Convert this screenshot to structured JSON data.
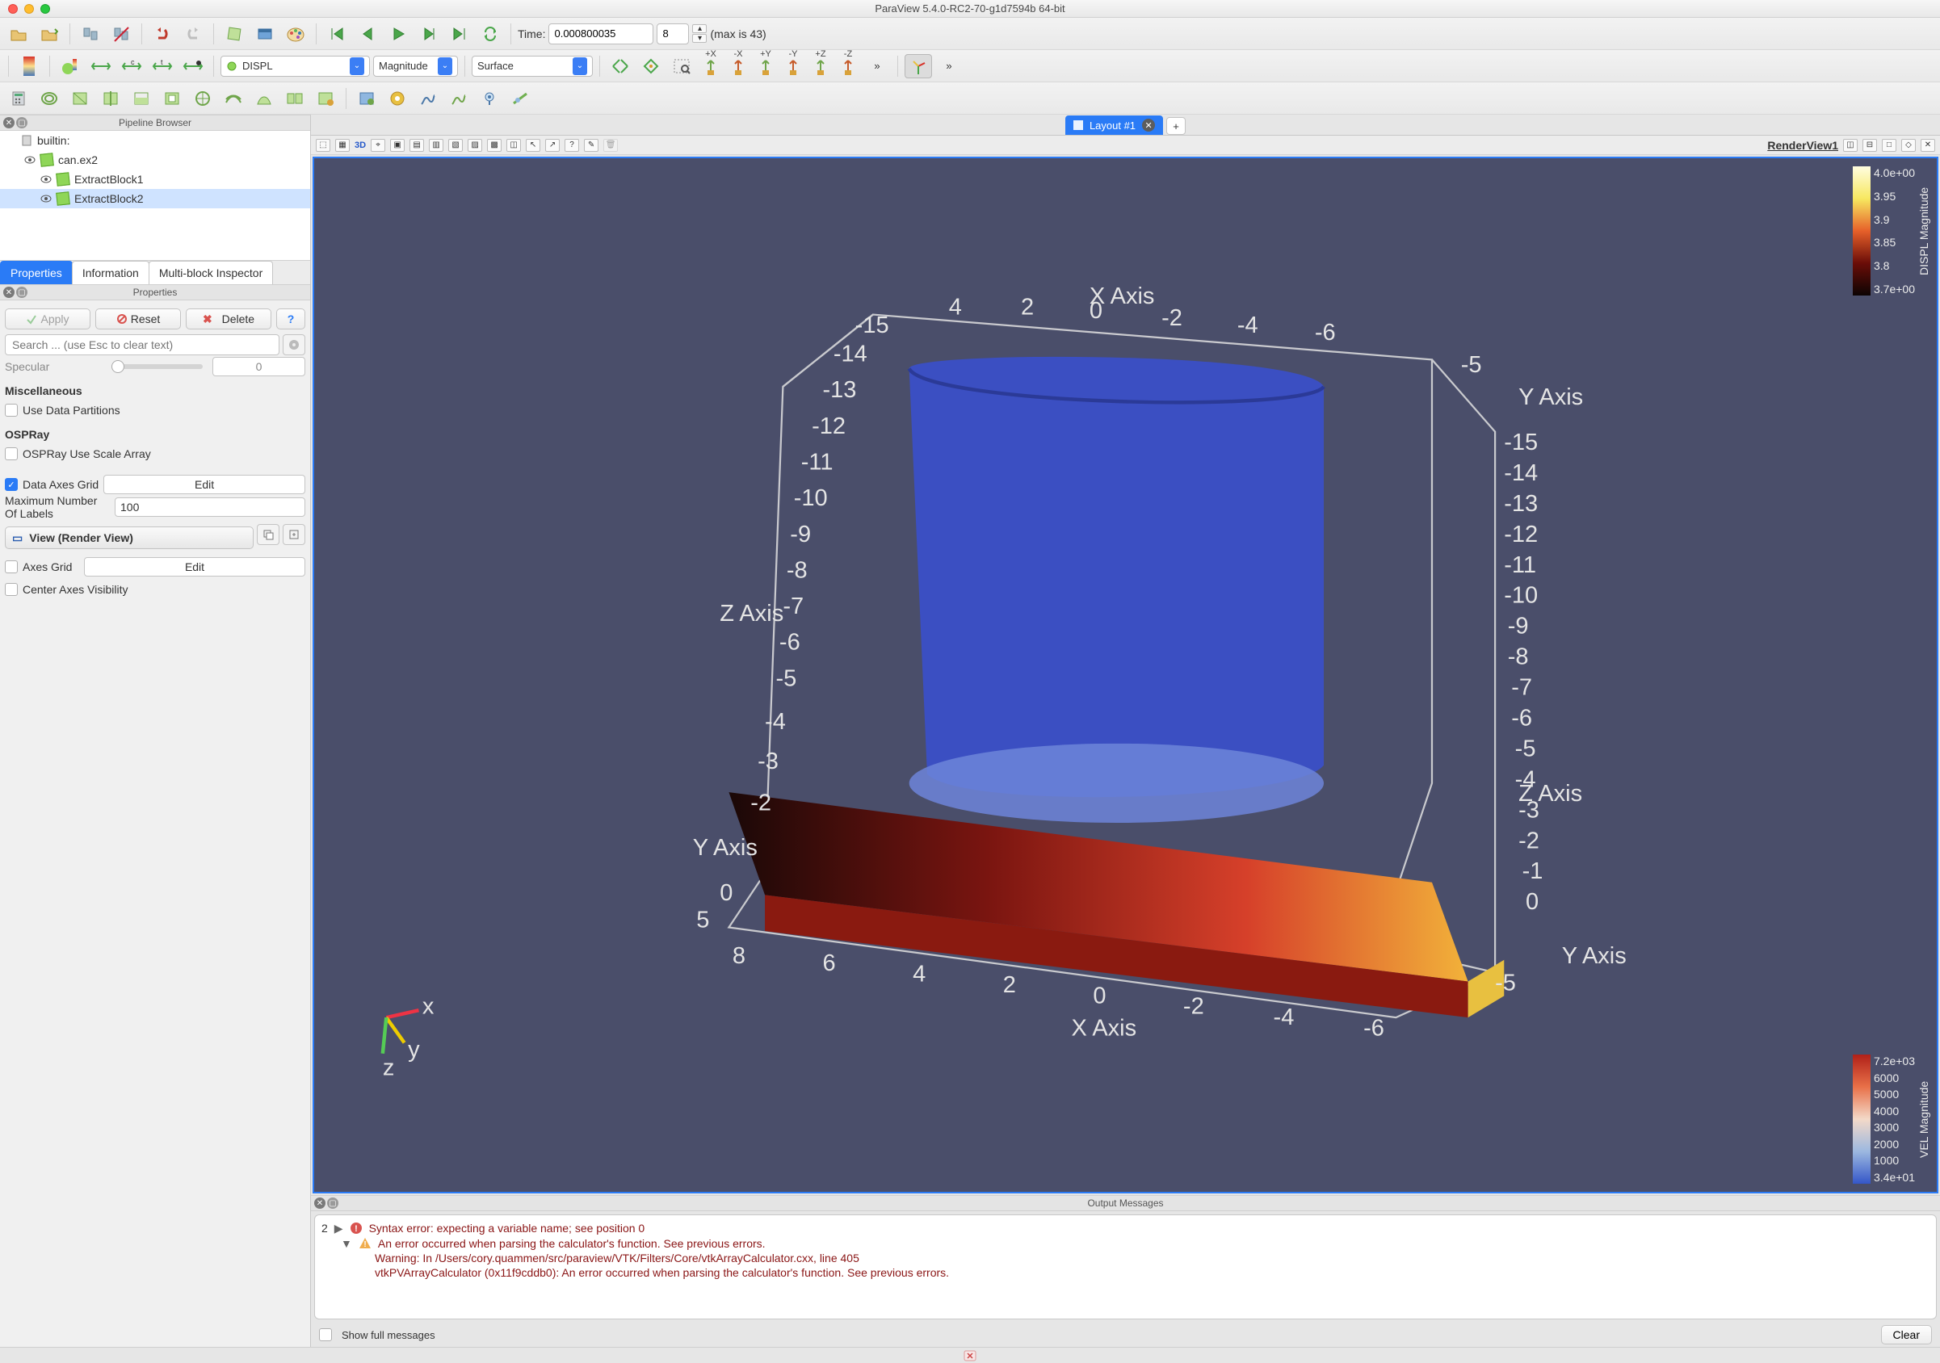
{
  "window": {
    "title": "ParaView 5.4.0-RC2-70-g1d7594b 64-bit"
  },
  "time": {
    "label": "Time:",
    "value": "0.000800035",
    "step": "8",
    "max_label": "(max is 43)"
  },
  "coloring": {
    "array": "DISPL",
    "component": "Magnitude",
    "repr": "Surface"
  },
  "axis_buttons": [
    "+X",
    "-X",
    "+Y",
    "-Y",
    "+Z",
    "-Z"
  ],
  "pipeline": {
    "title": "Pipeline Browser",
    "root": "builtin:",
    "items": [
      {
        "label": "can.ex2",
        "indent": 1,
        "selected": false
      },
      {
        "label": "ExtractBlock1",
        "indent": 2,
        "selected": false
      },
      {
        "label": "ExtractBlock2",
        "indent": 2,
        "selected": true
      }
    ]
  },
  "tabs": {
    "properties": "Properties",
    "information": "Information",
    "multiblock": "Multi-block Inspector"
  },
  "properties": {
    "title": "Properties",
    "apply": "Apply",
    "reset": "Reset",
    "delete": "Delete",
    "help": "?",
    "search_placeholder": "Search ... (use Esc to clear text)",
    "specular_label": "Specular",
    "specular_value": "0",
    "misc": "Miscellaneous",
    "use_data_partitions": "Use Data Partitions",
    "ospray": "OSPRay",
    "ospray_scale": "OSPRay Use Scale Array",
    "data_axes_grid": "Data Axes Grid",
    "edit": "Edit",
    "max_labels": "Maximum Number Of Labels",
    "max_labels_val": "100",
    "view_header": "View (Render View)",
    "axes_grid": "Axes Grid",
    "center_axes": "Center Axes Visibility"
  },
  "layout": {
    "tab": "Layout #1",
    "renderview": "RenderView1",
    "d3": "3D"
  },
  "legends": {
    "displ": {
      "label": "DISPL Magnitude",
      "ticks": [
        "4.0e+00",
        "3.95",
        "3.9",
        "3.85",
        "3.8",
        "3.7e+00"
      ]
    },
    "vel": {
      "label": "VEL Magnitude",
      "ticks": [
        "7.2e+03",
        "6000",
        "5000",
        "4000",
        "3000",
        "2000",
        "1000",
        "3.4e+01"
      ]
    }
  },
  "axes": {
    "x_label": "X Axis",
    "y_label": "Y Axis",
    "z_label": "Z Axis",
    "top_x": [
      "-15",
      "4",
      "2",
      "0",
      "-2",
      "-4",
      "-6"
    ],
    "left_z": [
      "-14",
      "-13",
      "-12",
      "-11",
      "-10",
      "-9",
      "-8",
      "-7",
      "-6",
      "-5",
      "-4",
      "-3",
      "-2"
    ],
    "right_y": [
      "-5",
      "-15",
      "-14",
      "-13",
      "-12",
      "-11",
      "-10",
      "-9",
      "-8",
      "-7",
      "-6",
      "-5",
      "-4",
      "-3",
      "-2",
      "-1",
      "0",
      "-5"
    ],
    "bot_x": [
      "8",
      "6",
      "4",
      "2",
      "0",
      "-2",
      "-4",
      "-6"
    ]
  },
  "output": {
    "title": "Output Messages",
    "count": "2",
    "lines": [
      "Syntax error: expecting a variable name;  see position 0",
      "An error occurred when parsing the calculator's function.  See previous errors.",
      "Warning: In /Users/cory.quammen/src/paraview/VTK/Filters/Core/vtkArrayCalculator.cxx, line 405",
      "vtkPVArrayCalculator (0x11f9cddb0): An error occurred when parsing the calculator's function.  See previous errors."
    ],
    "show_full": "Show full messages",
    "clear": "Clear"
  }
}
